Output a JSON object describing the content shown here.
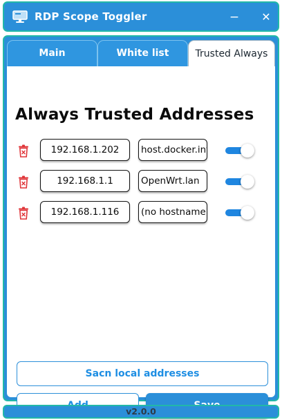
{
  "window": {
    "title": "RDP Scope Toggler",
    "app_icon": "monitor-icon",
    "minimize_glyph": "−",
    "close_glyph": "✕"
  },
  "tabs": [
    {
      "label": "Main",
      "active": false
    },
    {
      "label": "White list",
      "active": false
    },
    {
      "label": "Trusted Always",
      "active": true
    }
  ],
  "page": {
    "heading": "Always Trusted Addresses"
  },
  "entries": [
    {
      "ip": "192.168.1.202",
      "hostname": "host.docker.internal",
      "enabled": true
    },
    {
      "ip": "192.168.1.1",
      "hostname": "OpenWrt.lan",
      "enabled": true
    },
    {
      "ip": "192.168.1.116",
      "hostname": "(no hostname)",
      "enabled": true
    }
  ],
  "actions": {
    "scan_label": "Sacn local addresses",
    "add_label": "Add",
    "save_label": "Save"
  },
  "footer": {
    "version": "v2.0.0"
  },
  "colors": {
    "accent": "#2b8fd9",
    "border_teal": "#22b8a8",
    "delete_red": "#e0363a"
  }
}
